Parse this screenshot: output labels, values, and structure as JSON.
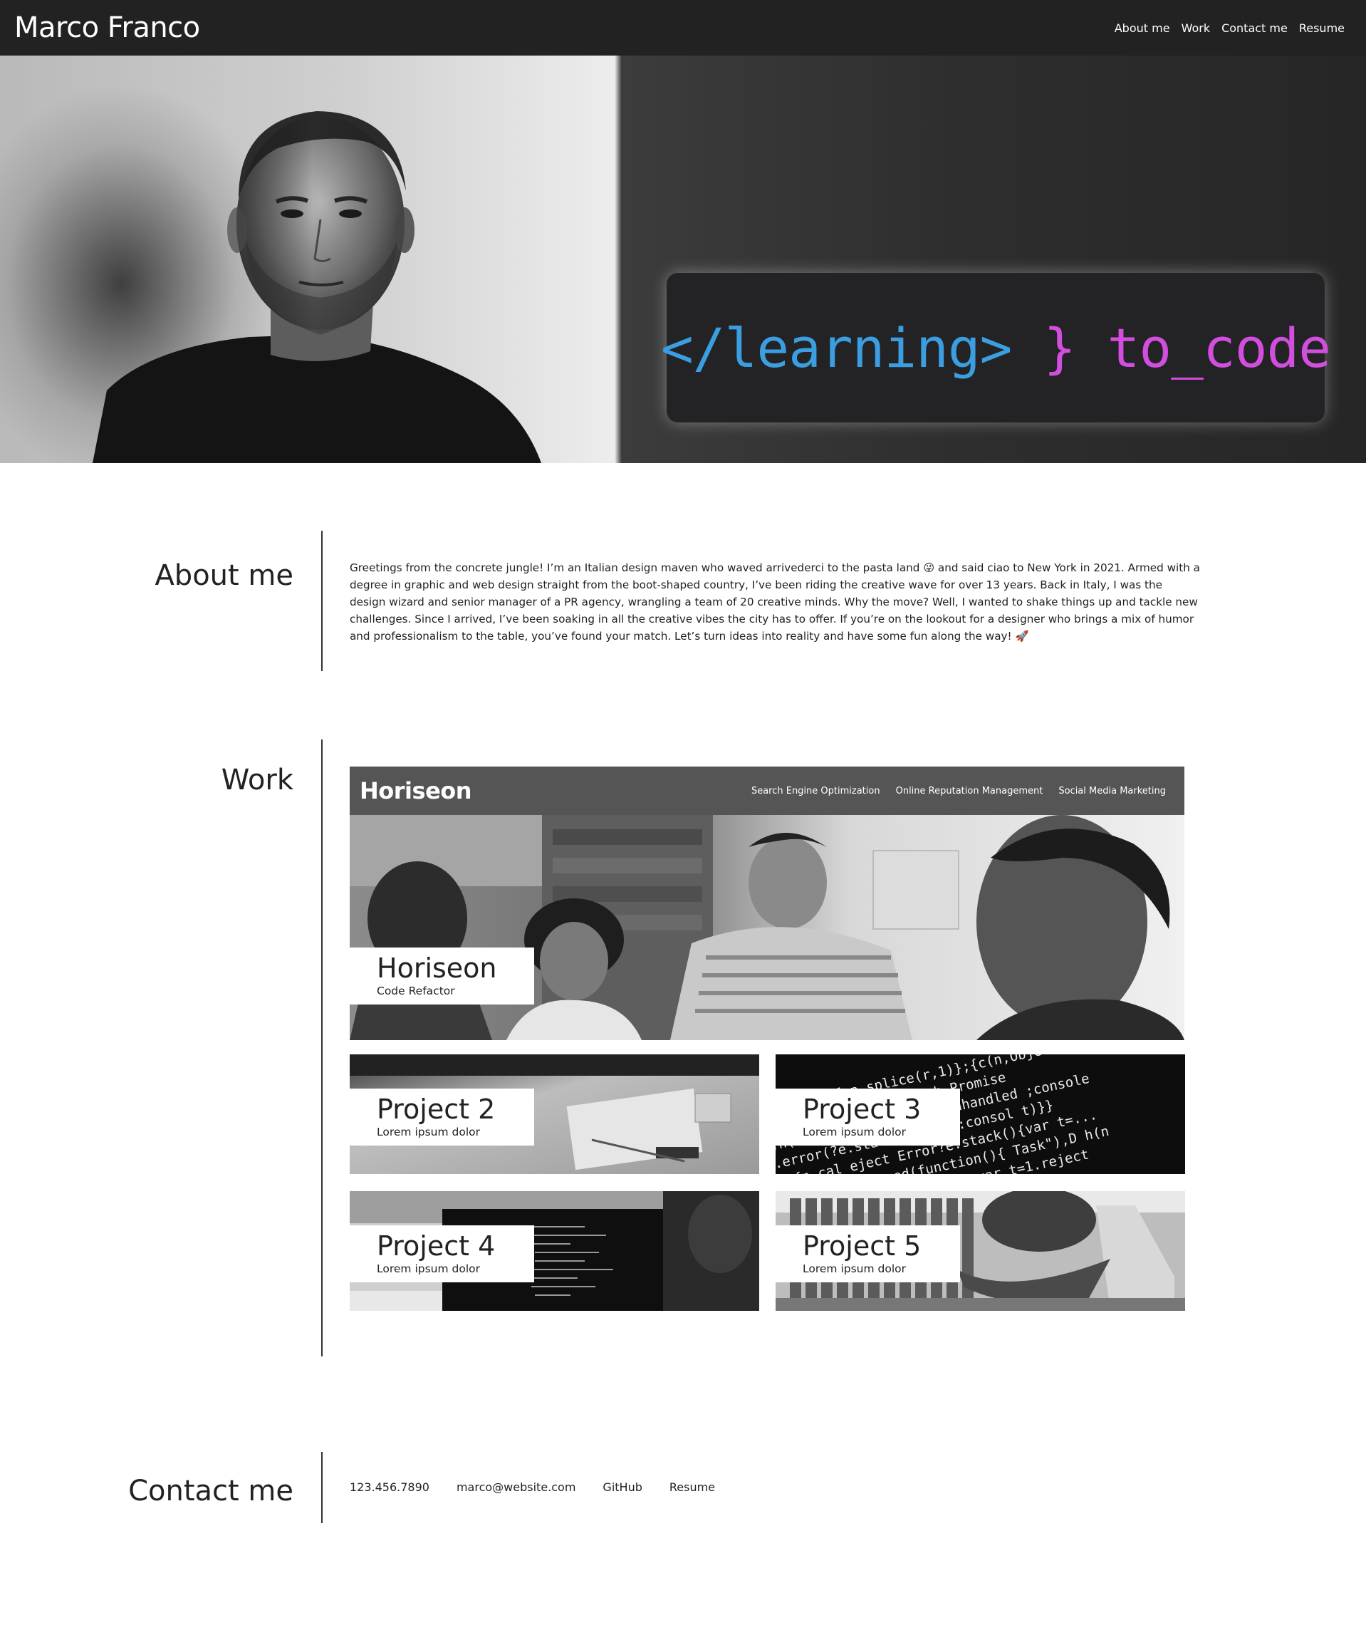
{
  "header": {
    "title": "Marco Franco",
    "nav": [
      "About me",
      "Work",
      "Contact me",
      "Resume"
    ]
  },
  "hero": {
    "code_tag": "</learning>",
    "code_brace": "}",
    "code_fn": "to_code",
    "colors": {
      "tag": "#3a9ee0",
      "accent": "#d24ede"
    }
  },
  "about": {
    "heading": "About me",
    "text": "Greetings from the concrete jungle! I’m an Italian design maven who waved arrivederci to the pasta land 😜 and said ciao to New York in 2021. Armed with a degree in graphic and web design straight from the boot-shaped country, I’ve been riding the creative wave for over 13 years. Back in Italy, I was the design wizard and senior manager of a PR agency, wrangling a team of 20 creative minds. Why the move? Well, I wanted to shake things up and tackle new challenges. Since I arrived, I’ve been soaking in all the creative vibes the city has to offer. If you’re on the lookout for a designer who brings a mix of humor and professionalism to the table, you’ve found your match. Let’s turn ideas into reality and have some fun along the way! 🚀"
  },
  "work": {
    "heading": "Work",
    "featured": {
      "logo": "Horiseon",
      "nav": [
        "Search Engine Optimization",
        "Online Reputation Management",
        "Social Media Marketing"
      ],
      "title": "Horiseon",
      "subtitle": "Code Refactor"
    },
    "projects": [
      {
        "title": "Project 2",
        "subtitle": "Lorem ipsum dolor"
      },
      {
        "title": "Project 3",
        "subtitle": "Lorem ipsum dolor"
      },
      {
        "title": "Project 4",
        "subtitle": "Lorem ipsum dolor"
      },
      {
        "title": "Project 5",
        "subtitle": "Lorem ipsum dolor"
      }
    ]
  },
  "contact": {
    "heading": "Contact me",
    "links": [
      "123.456.7890",
      "marco@website.com",
      "GitHub",
      "Resume"
    ]
  }
}
